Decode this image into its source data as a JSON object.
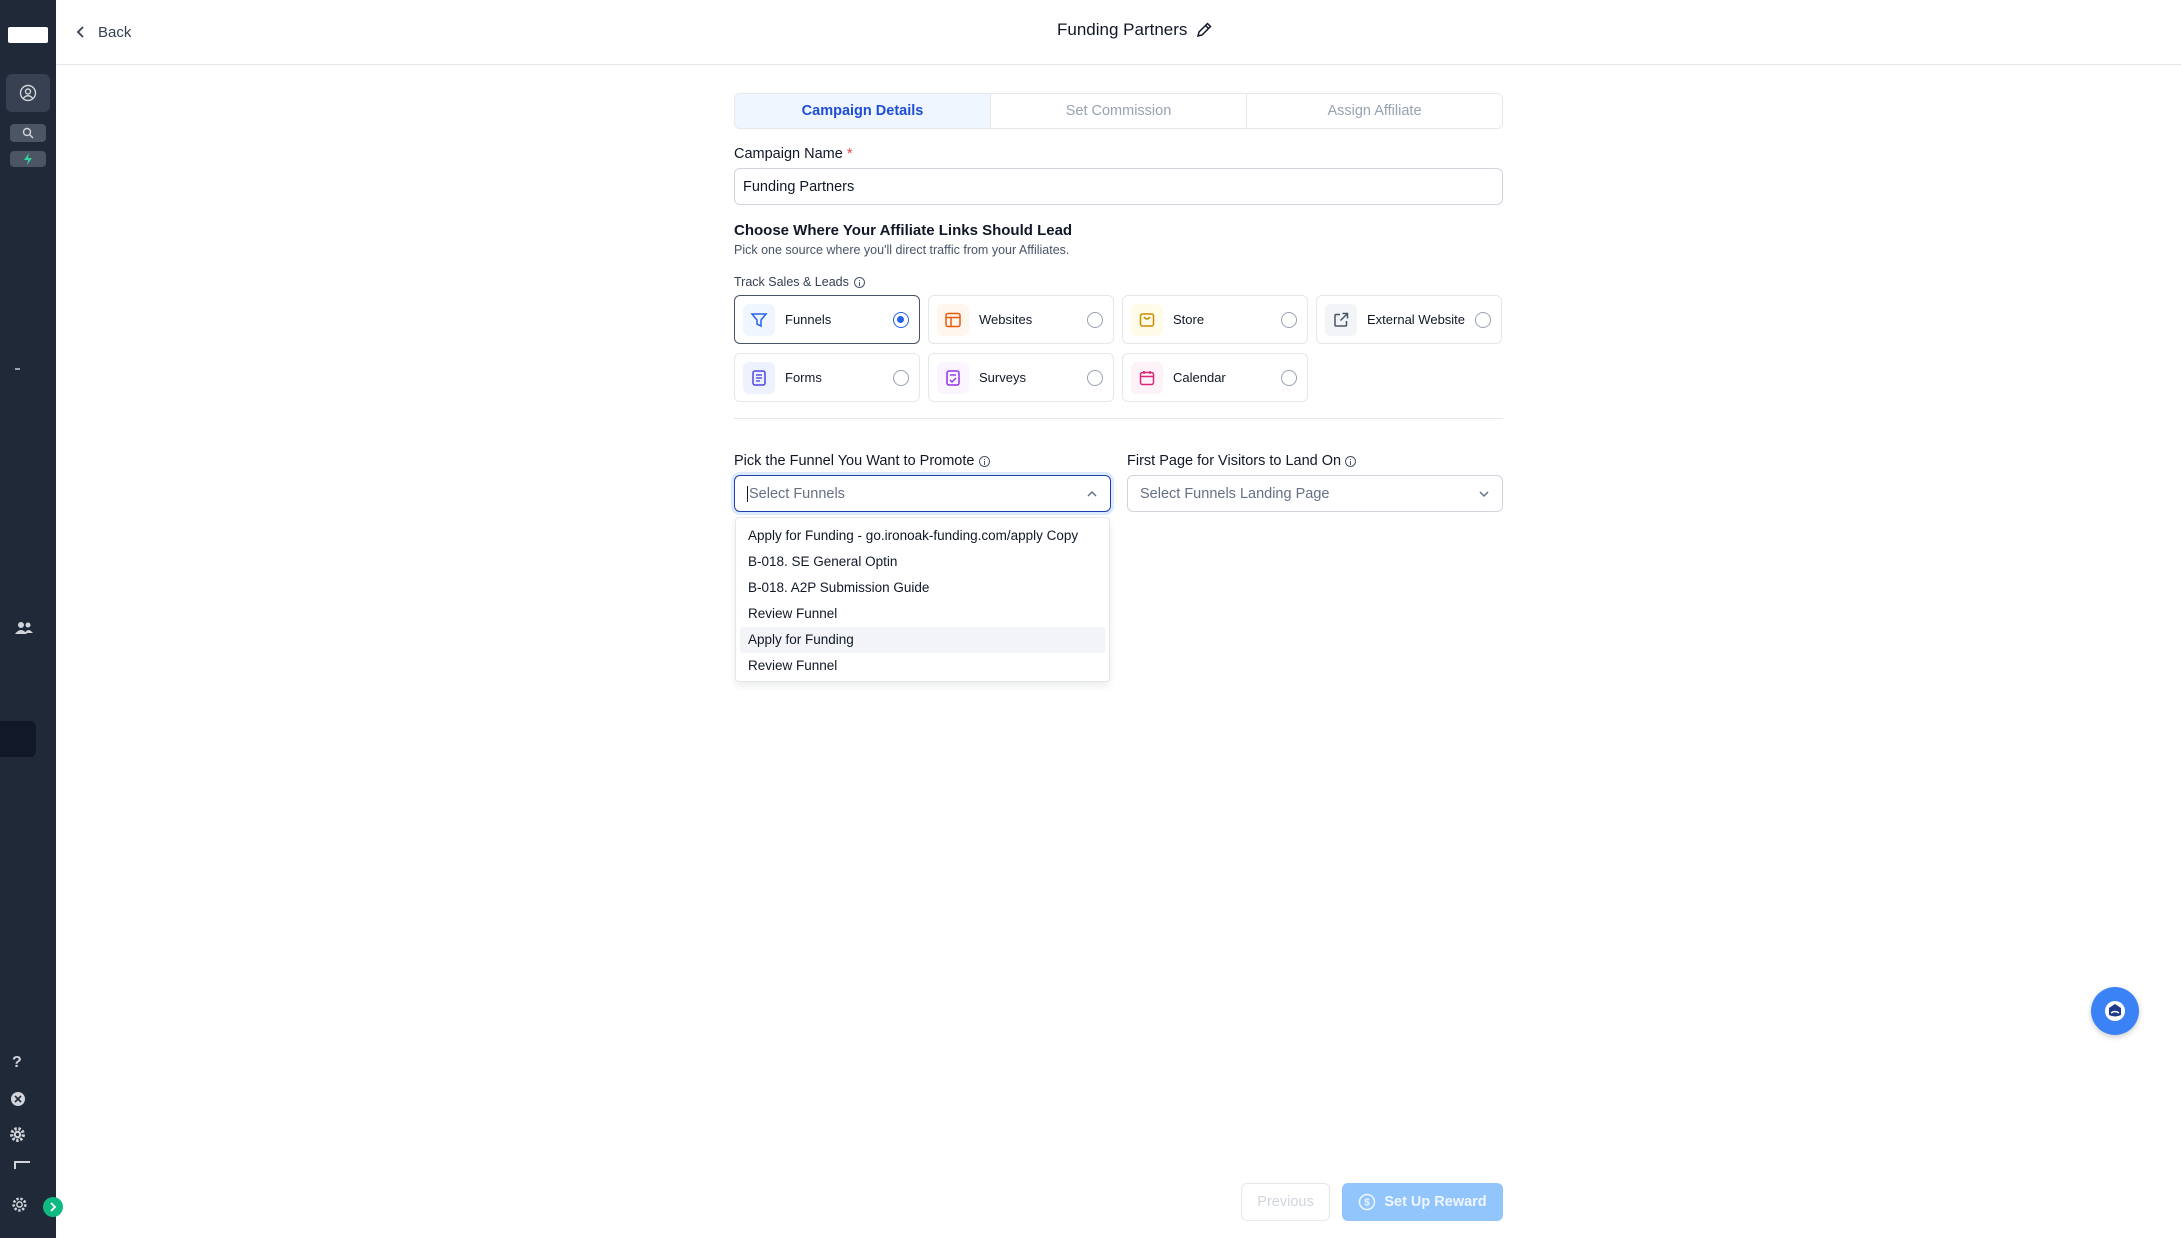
{
  "topbar": {
    "back_label": "Back",
    "title": "Funding Partners"
  },
  "tabs": [
    {
      "label": "Campaign Details",
      "active": true
    },
    {
      "label": "Set Commission",
      "active": false
    },
    {
      "label": "Assign Affiliate",
      "active": false
    }
  ],
  "form": {
    "campaign_name_label": "Campaign Name",
    "required_mark": "*",
    "campaign_name_value": "Funding Partners",
    "destination_heading": "Choose Where Your Affiliate Links Should Lead",
    "destination_subtext": "Pick one source where you'll direct traffic from your Affiliates.",
    "track_label": "Track Sales & Leads"
  },
  "sources": [
    {
      "label": "Funnels",
      "icon": "funnel-icon",
      "selected": true,
      "color": "#2563eb",
      "bg": "#eff6ff"
    },
    {
      "label": "Websites",
      "icon": "website-icon",
      "selected": false,
      "color": "#ea580c",
      "bg": "#fff7ed"
    },
    {
      "label": "Store",
      "icon": "store-icon",
      "selected": false,
      "color": "#ca8a04",
      "bg": "#fefce8"
    },
    {
      "label": "External Website",
      "icon": "external-link-icon",
      "selected": false,
      "color": "#475467",
      "bg": "#f2f4f7"
    },
    {
      "label": "Forms",
      "icon": "form-icon",
      "selected": false,
      "color": "#4f46e5",
      "bg": "#eef2ff"
    },
    {
      "label": "Surveys",
      "icon": "survey-icon",
      "selected": false,
      "color": "#9333ea",
      "bg": "#faf5ff"
    },
    {
      "label": "Calendar",
      "icon": "calendar-icon",
      "selected": false,
      "color": "#db2777",
      "bg": "#fdf2f8"
    }
  ],
  "funnel_picker": {
    "label": "Pick the Funnel You Want to Promote",
    "placeholder": "Select Funnels",
    "options": [
      "Apply for Funding - go.ironoak-funding.com/apply Copy",
      "B-018. SE General Optin",
      "B-018. A2P Submission Guide",
      "Review Funnel",
      "Apply for Funding",
      "Review Funnel"
    ],
    "highlighted_index": 4
  },
  "landing_picker": {
    "label": "First Page for Visitors to Land On",
    "placeholder": "Select Funnels Landing Page"
  },
  "footer": {
    "previous_label": "Previous",
    "next_label": "Set Up Reward"
  },
  "colors": {
    "accent": "#1d4ed8",
    "sidebar": "#1f2937",
    "primary_disabled": "#93c5fd"
  }
}
